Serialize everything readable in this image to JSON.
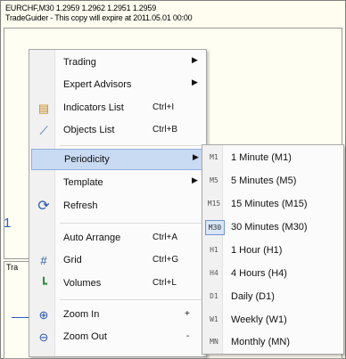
{
  "chart": {
    "header_line1": "EURCHF,M30  1.2959 1.2962 1.2951 1.2959",
    "header_line2": "TradeGuider - This copy will expire at 2011.05.01 00:00",
    "price_fragment": "1",
    "subwindow_label": "Tra"
  },
  "menu": {
    "items": [
      {
        "label": "Trading",
        "shortcut": "",
        "has_submenu": true,
        "icon": ""
      },
      {
        "label": "Expert Advisors",
        "shortcut": "",
        "has_submenu": true,
        "icon": ""
      },
      {
        "label": "Indicators List",
        "shortcut": "Ctrl+I",
        "has_submenu": false,
        "icon": "indicators-list-icon"
      },
      {
        "label": "Objects List",
        "shortcut": "Ctrl+B",
        "has_submenu": false,
        "icon": "objects-list-icon"
      },
      {
        "label": "Periodicity",
        "shortcut": "",
        "has_submenu": true,
        "icon": ""
      },
      {
        "label": "Template",
        "shortcut": "",
        "has_submenu": true,
        "icon": ""
      },
      {
        "label": "Refresh",
        "shortcut": "",
        "has_submenu": false,
        "icon": "refresh-icon"
      },
      {
        "label": "Auto Arrange",
        "shortcut": "Ctrl+A",
        "has_submenu": false,
        "icon": ""
      },
      {
        "label": "Grid",
        "shortcut": "Ctrl+G",
        "has_submenu": false,
        "icon": "grid-icon"
      },
      {
        "label": "Volumes",
        "shortcut": "Ctrl+L",
        "has_submenu": false,
        "icon": "volumes-icon"
      },
      {
        "label": "Zoom In",
        "shortcut": "+",
        "has_submenu": false,
        "icon": "zoom-in-icon"
      },
      {
        "label": "Zoom Out",
        "shortcut": "-",
        "has_submenu": false,
        "icon": "zoom-out-icon"
      }
    ],
    "highlighted": "Periodicity",
    "arrow": "▶",
    "icons": {
      "indicators": "▤",
      "objects": "⟋",
      "refresh": "⟳",
      "grid": "#",
      "volumes": "┗",
      "zoom_in": "⊕",
      "zoom_out": "⊖"
    }
  },
  "periodicity": {
    "items": [
      {
        "code": "M1",
        "label": "1 Minute (M1)"
      },
      {
        "code": "M5",
        "label": "5 Minutes (M5)"
      },
      {
        "code": "M15",
        "label": "15 Minutes (M15)"
      },
      {
        "code": "M30",
        "label": "30 Minutes (M30)",
        "checked": true
      },
      {
        "code": "H1",
        "label": "1 Hour (H1)"
      },
      {
        "code": "H4",
        "label": "4 Hours (H4)"
      },
      {
        "code": "D1",
        "label": "Daily (D1)"
      },
      {
        "code": "W1",
        "label": "Weekly (W1)"
      },
      {
        "code": "MN",
        "label": "Monthly (MN)"
      }
    ]
  },
  "colors": {
    "highlight": "#c9daf3",
    "chart_bg": "#fffdf0",
    "series": "#2b5fbd"
  }
}
